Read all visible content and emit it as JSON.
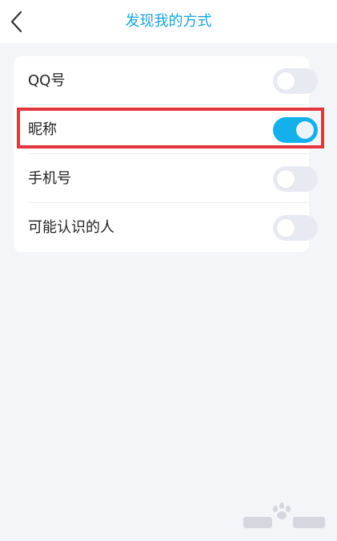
{
  "header": {
    "title": "发现我的方式"
  },
  "settings": {
    "items": [
      {
        "label": "QQ号",
        "enabled": false
      },
      {
        "label": "昵称",
        "enabled": true
      },
      {
        "label": "手机号",
        "enabled": false
      },
      {
        "label": "可能认识的人",
        "enabled": false
      }
    ]
  },
  "icons": {
    "back": "chevron-left-icon",
    "watermark": "baidu-jingyan-watermark"
  },
  "colors": {
    "accent": "#14b0ec",
    "title": "#1aa4dc",
    "toggle_off": "#e8eaf1",
    "highlight": "#e2363c",
    "background": "#f4f5f9"
  }
}
